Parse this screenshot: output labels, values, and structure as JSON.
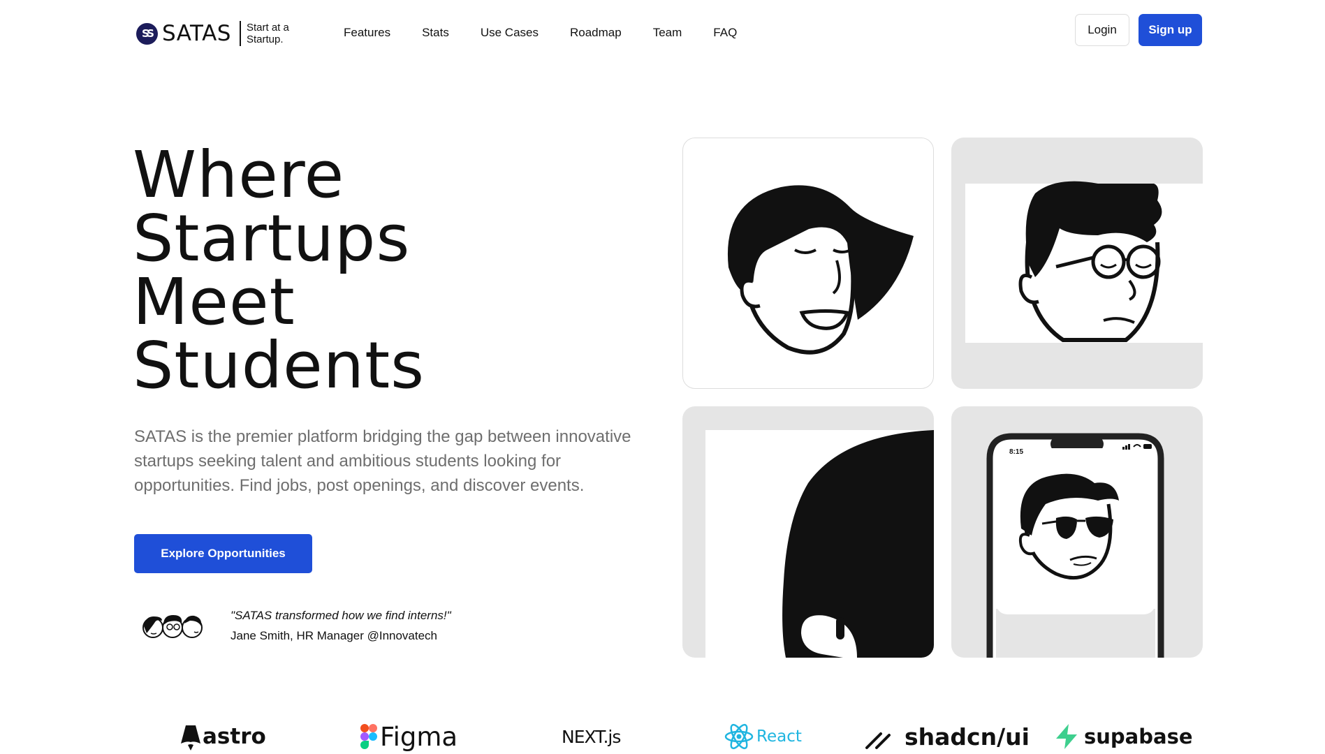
{
  "nav": {
    "brand_mark": "SS",
    "brand_name": "SATAS",
    "brand_tagline": "Start at a Startup.",
    "links": [
      "Features",
      "Stats",
      "Use Cases",
      "Roadmap",
      "Team",
      "FAQ"
    ],
    "login_label": "Login",
    "signup_label": "Sign up"
  },
  "hero": {
    "title_lines": [
      "Where",
      "Startups",
      "Meet",
      "Students"
    ],
    "description": "SATAS is the premier platform bridging the gap between innovative startups seeking talent and ambitious students looking for opportunities. Find jobs, post openings, and discover events.",
    "cta_label": "Explore Opportunities",
    "testimonial_quote": "\"SATAS transformed how we find interns!\"",
    "testimonial_author": "Jane Smith, HR Manager @Innovatech"
  },
  "phone": {
    "time": "8:15"
  },
  "logos": {
    "astro": "astro",
    "figma": "Figma",
    "next": "NEXT.js",
    "react": "React",
    "shadcn": "shadcn/ui",
    "supabase": "supabase"
  },
  "colors": {
    "primary": "#1f4fd8",
    "card_gray": "#e5e5e5",
    "react": "#1fb5e0",
    "supabase": "#3ecf8e"
  }
}
